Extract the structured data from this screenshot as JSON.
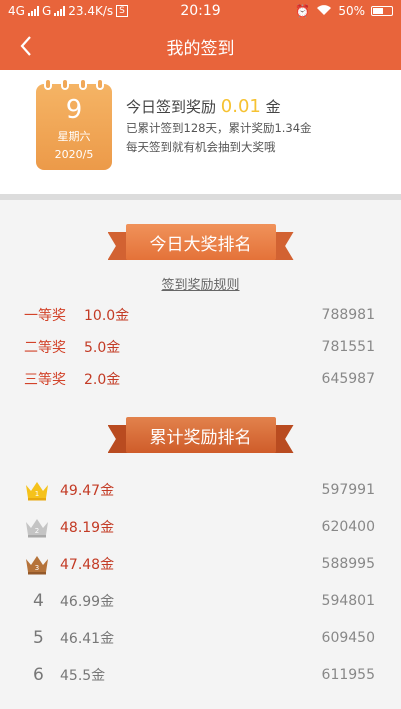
{
  "status_bar": {
    "network_left": "4G",
    "network_right": "G",
    "speed": "23.4K/s",
    "sim_badge": "S",
    "time": "20:19",
    "battery": "50%"
  },
  "nav": {
    "back_icon": "chevron-left-icon",
    "title": "我的签到"
  },
  "checkin": {
    "day": "9",
    "weekday": "星期六",
    "year_month": "2020/5",
    "today_prefix": "今日签到奖励",
    "today_amount": "0.01",
    "today_unit": "金",
    "summary": "已累计签到128天，累计奖励1.34金",
    "hint": "每天签到就有机会抽到大奖哦"
  },
  "daily_ranking": {
    "title": "今日大奖排名",
    "rules_link": "签到奖励规则",
    "prizes": [
      {
        "name": "一等奖",
        "amount": "10.0金",
        "count": "788981"
      },
      {
        "name": "二等奖",
        "amount": "5.0金",
        "count": "781551"
      },
      {
        "name": "三等奖",
        "amount": "2.0金",
        "count": "645987"
      }
    ]
  },
  "cumulative_ranking": {
    "title": "累计奖励排名",
    "rows": [
      {
        "rank": "1",
        "amount": "49.47金",
        "count": "597991",
        "crown": "gold"
      },
      {
        "rank": "2",
        "amount": "48.19金",
        "count": "620400",
        "crown": "silver"
      },
      {
        "rank": "3",
        "amount": "47.48金",
        "count": "588995",
        "crown": "bronze"
      },
      {
        "rank": "4",
        "amount": "46.99金",
        "count": "594801"
      },
      {
        "rank": "5",
        "amount": "46.41金",
        "count": "609450"
      },
      {
        "rank": "6",
        "amount": "45.5金",
        "count": "611955"
      }
    ]
  },
  "colors": {
    "header": "#e8643b",
    "accent_red": "#c33b25",
    "crown_gold": "#f5c21b",
    "crown_silver": "#b9b9b9",
    "crown_bronze": "#b5733a"
  }
}
